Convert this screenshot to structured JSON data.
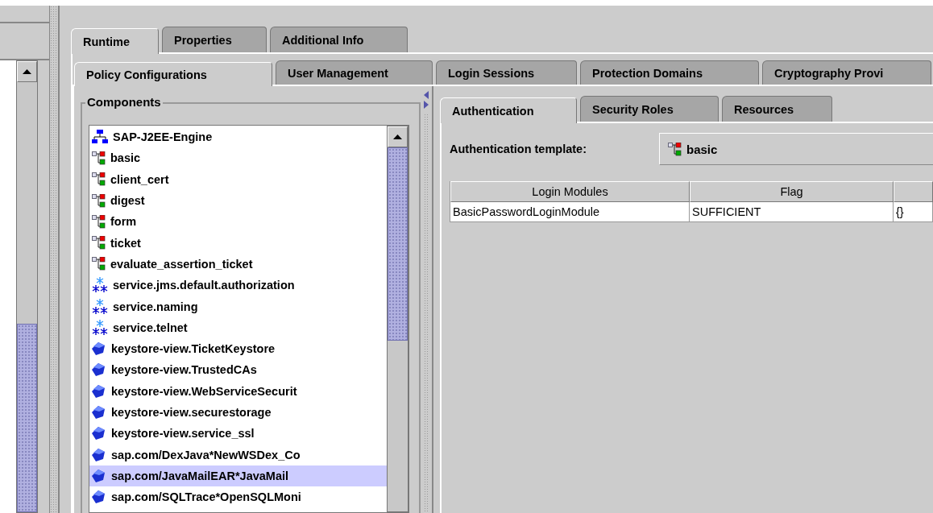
{
  "main_tabs": [
    {
      "label": "Runtime",
      "selected": true
    },
    {
      "label": "Properties",
      "selected": false
    },
    {
      "label": "Additional Info",
      "selected": false
    }
  ],
  "sub_tabs": [
    {
      "label": "Policy Configurations",
      "selected": true
    },
    {
      "label": "User Management",
      "selected": false
    },
    {
      "label": "Login Sessions",
      "selected": false
    },
    {
      "label": "Protection Domains",
      "selected": false
    },
    {
      "label": "Cryptography Provi",
      "selected": false
    }
  ],
  "components": {
    "title": "Components",
    "items": [
      {
        "label": "SAP-J2EE-Engine",
        "kind": "engine",
        "selected": false
      },
      {
        "label": "basic",
        "kind": "template",
        "selected": false
      },
      {
        "label": "client_cert",
        "kind": "template",
        "selected": false
      },
      {
        "label": "digest",
        "kind": "template",
        "selected": false
      },
      {
        "label": "form",
        "kind": "template",
        "selected": false
      },
      {
        "label": "ticket",
        "kind": "template",
        "selected": false
      },
      {
        "label": "evaluate_assertion_ticket",
        "kind": "template",
        "selected": false
      },
      {
        "label": "service.jms.default.authorization",
        "kind": "service",
        "selected": false
      },
      {
        "label": "service.naming",
        "kind": "service",
        "selected": false
      },
      {
        "label": "service.telnet",
        "kind": "service",
        "selected": false
      },
      {
        "label": "keystore-view.TicketKeystore",
        "kind": "keystore",
        "selected": false
      },
      {
        "label": "keystore-view.TrustedCAs",
        "kind": "keystore",
        "selected": false
      },
      {
        "label": "keystore-view.WebServiceSecurit",
        "kind": "keystore",
        "selected": false
      },
      {
        "label": "keystore-view.securestorage",
        "kind": "keystore",
        "selected": false
      },
      {
        "label": "keystore-view.service_ssl",
        "kind": "keystore",
        "selected": false
      },
      {
        "label": "sap.com/DexJava*NewWSDex_Co",
        "kind": "keystore",
        "selected": false
      },
      {
        "label": "sap.com/JavaMailEAR*JavaMail",
        "kind": "keystore",
        "selected": true
      },
      {
        "label": "sap.com/SQLTrace*OpenSQLMoni",
        "kind": "keystore",
        "selected": false
      }
    ]
  },
  "detail_tabs": [
    {
      "label": "Authentication",
      "selected": true
    },
    {
      "label": "Security Roles",
      "selected": false
    },
    {
      "label": "Resources",
      "selected": false
    }
  ],
  "authentication_template": {
    "label": "Authentication template:",
    "value": "basic",
    "kind": "template"
  },
  "table": {
    "columns": [
      "Login Modules",
      "Flag"
    ],
    "rows": [
      [
        "BasicPasswordLoginModule",
        "SUFFICIENT",
        "{}"
      ]
    ]
  }
}
